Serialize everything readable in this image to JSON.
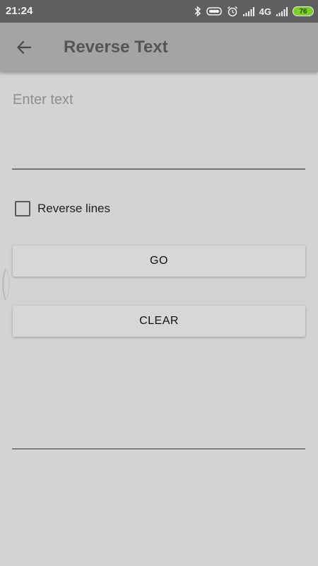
{
  "status_bar": {
    "time": "21:24",
    "network": "4G",
    "battery_level": "76",
    "icons": [
      "bluetooth-icon",
      "vr-headset-icon",
      "alarm-icon",
      "signal-icon",
      "signal-icon",
      "battery-icon"
    ]
  },
  "toolbar": {
    "title": "Reverse Text",
    "back_icon": "arrow-left-icon"
  },
  "input": {
    "placeholder": "Enter text",
    "value": ""
  },
  "options": {
    "reverse_lines_label": "Reverse lines",
    "reverse_lines_checked": false
  },
  "buttons": {
    "go_label": "GO",
    "clear_label": "CLEAR"
  },
  "output": {
    "text": ""
  },
  "colors": {
    "status_bar": "#5f5f5f",
    "toolbar": "#a4a4a4",
    "background": "#d3d3d3",
    "button": "#d6d7d7",
    "battery": "#7ccf27"
  }
}
